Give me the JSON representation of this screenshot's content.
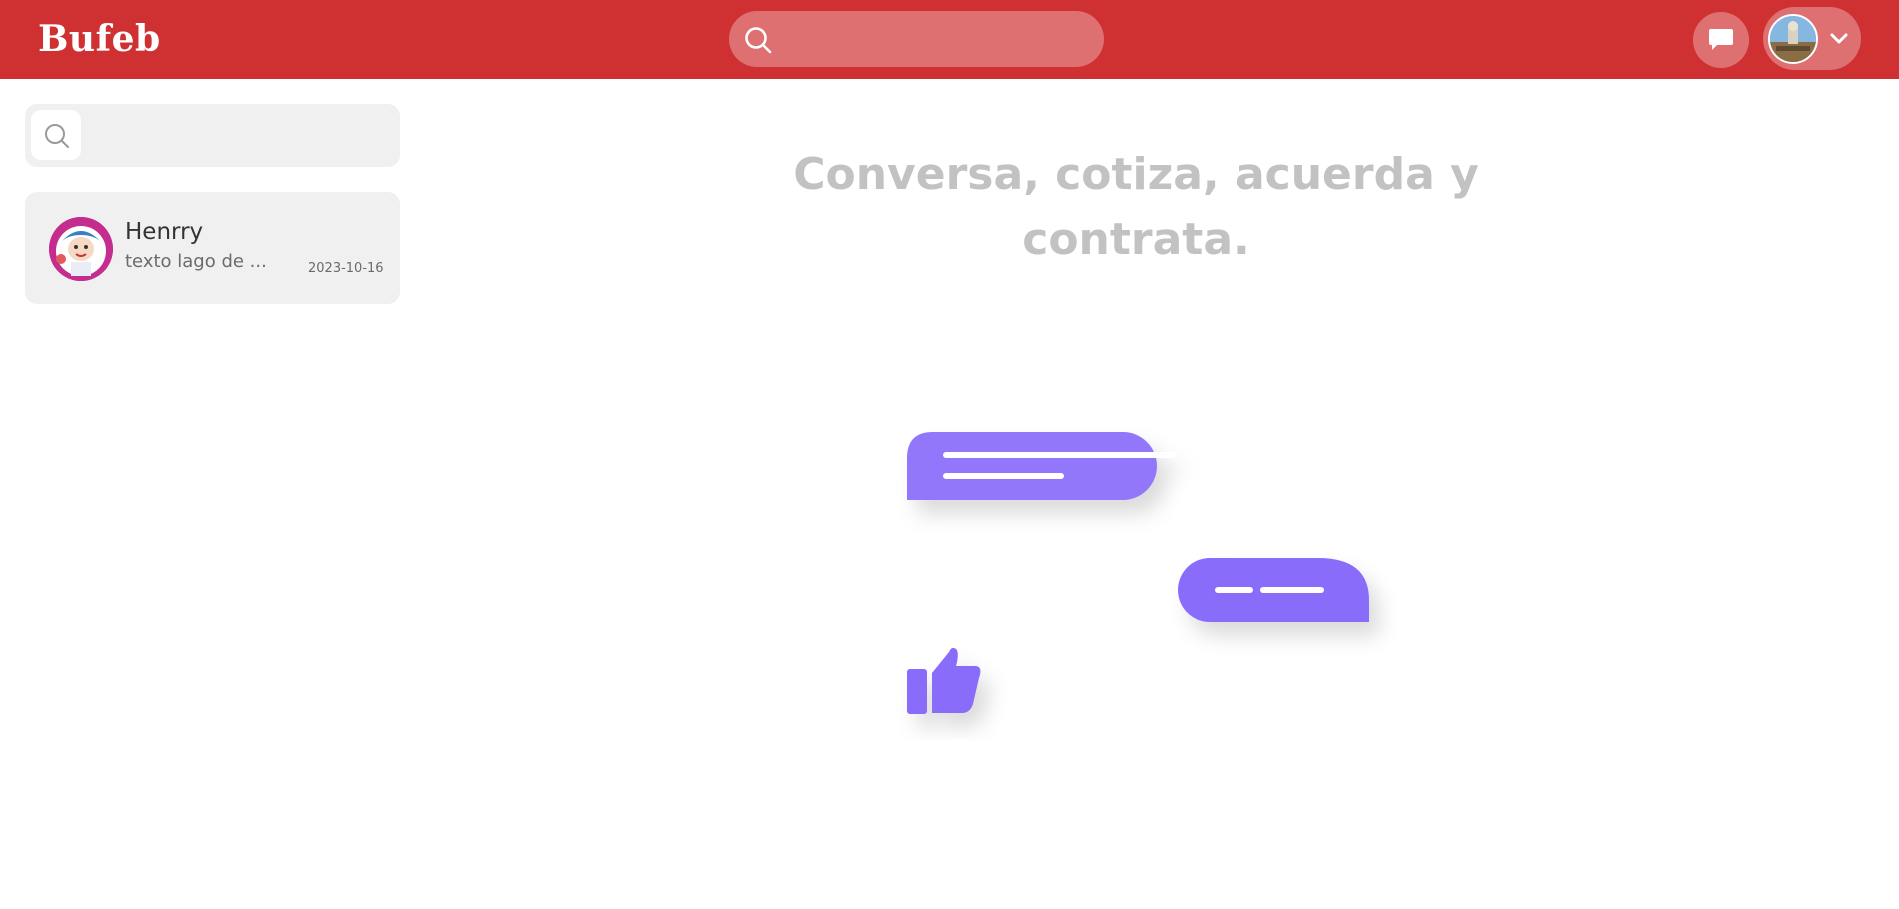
{
  "app": {
    "logo": "Bufeb"
  },
  "header": {
    "search": {
      "placeholder": "",
      "value": ""
    },
    "icons": {
      "search": "search-icon",
      "messages": "chat-bubble-icon",
      "dropdown": "chevron-down-icon"
    }
  },
  "sidebar": {
    "search": {
      "placeholder": "",
      "value": ""
    },
    "conversations": [
      {
        "name": "Henrry",
        "preview": "texto lago de ...",
        "date": "2023-10-16"
      }
    ]
  },
  "main": {
    "headline_line1": "Conversa, cotiza, acuerda y",
    "headline_line2": "contrata."
  },
  "colors": {
    "brand_red": "#cf3133",
    "header_pill": "#de7072",
    "panel_gray": "#f0f0f0",
    "headline_gray": "#c3c2c2",
    "illustration_purple": "#8a6cfa"
  }
}
